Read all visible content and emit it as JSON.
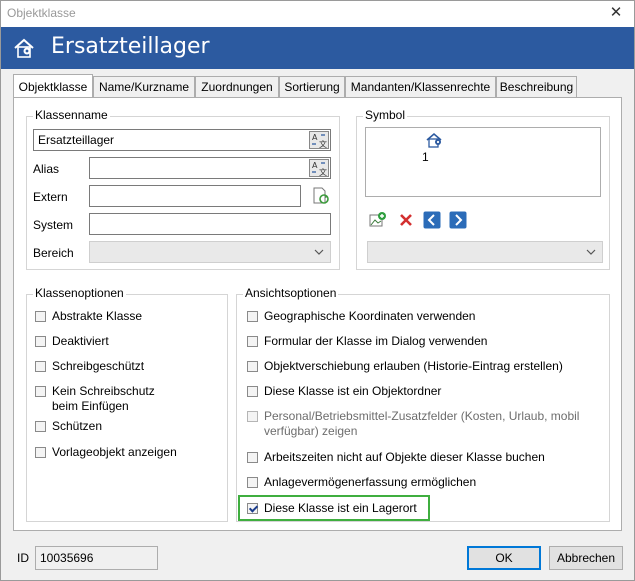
{
  "window": {
    "title": "Objektklasse",
    "close_glyph": "✕"
  },
  "header": {
    "title": "Ersatzteillager",
    "icon": "house-location-icon"
  },
  "tabs": [
    {
      "label": "Objektklasse",
      "active": true
    },
    {
      "label": "Name/Kurzname"
    },
    {
      "label": "Zuordnungen"
    },
    {
      "label": "Sortierung"
    },
    {
      "label": "Mandanten/Klassenrechte"
    },
    {
      "label": "Beschreibung"
    }
  ],
  "classname": {
    "group_title": "Klassenname",
    "name_value": "Ersatzteillager",
    "alias_label": "Alias",
    "alias_value": "",
    "extern_label": "Extern",
    "extern_value": "",
    "system_label": "System",
    "system_value": "",
    "bereich_label": "Bereich",
    "bereich_value": ""
  },
  "symbol": {
    "group_title": "Symbol",
    "number": "1",
    "combo_value": ""
  },
  "class_options": {
    "group_title": "Klassenoptionen",
    "items": [
      {
        "label": "Abstrakte Klasse",
        "checked": false
      },
      {
        "label": "Deaktiviert",
        "checked": false
      },
      {
        "label": "Schreibgeschützt",
        "checked": false
      },
      {
        "label": "Kein Schreibschutz\nbeim Einfügen",
        "checked": false
      },
      {
        "label": "Schützen",
        "checked": false
      },
      {
        "label": "Vorlageobjekt anzeigen",
        "checked": false
      }
    ]
  },
  "view_options": {
    "group_title": "Ansichtsoptionen",
    "items": [
      {
        "label": "Geographische Koordinaten verwenden",
        "checked": false
      },
      {
        "label": "Formular der Klasse im Dialog verwenden",
        "checked": false
      },
      {
        "label": "Objektverschiebung erlauben (Historie-Eintrag erstellen)",
        "checked": false
      },
      {
        "label": "Diese Klasse ist ein Objektordner",
        "checked": false
      },
      {
        "label": "Personal/Betriebsmittel-Zusatzfelder (Kosten, Urlaub, mobil verfügbar) zeigen",
        "checked": false,
        "disabled": true
      },
      {
        "label": "Arbeitszeiten nicht auf Objekte dieser Klasse buchen",
        "checked": false
      },
      {
        "label": "Anlagevermögenerfassung ermöglichen",
        "checked": false
      },
      {
        "label": "Diese Klasse ist ein Lagerort",
        "checked": true
      }
    ]
  },
  "footer": {
    "id_label": "ID",
    "id_value": "10035696",
    "ok_label": "OK",
    "cancel_label": "Abbrechen"
  },
  "colors": {
    "header_bg": "#2c5aa0",
    "highlight": "#3fae3f",
    "panel_bg": "#ffffff"
  }
}
